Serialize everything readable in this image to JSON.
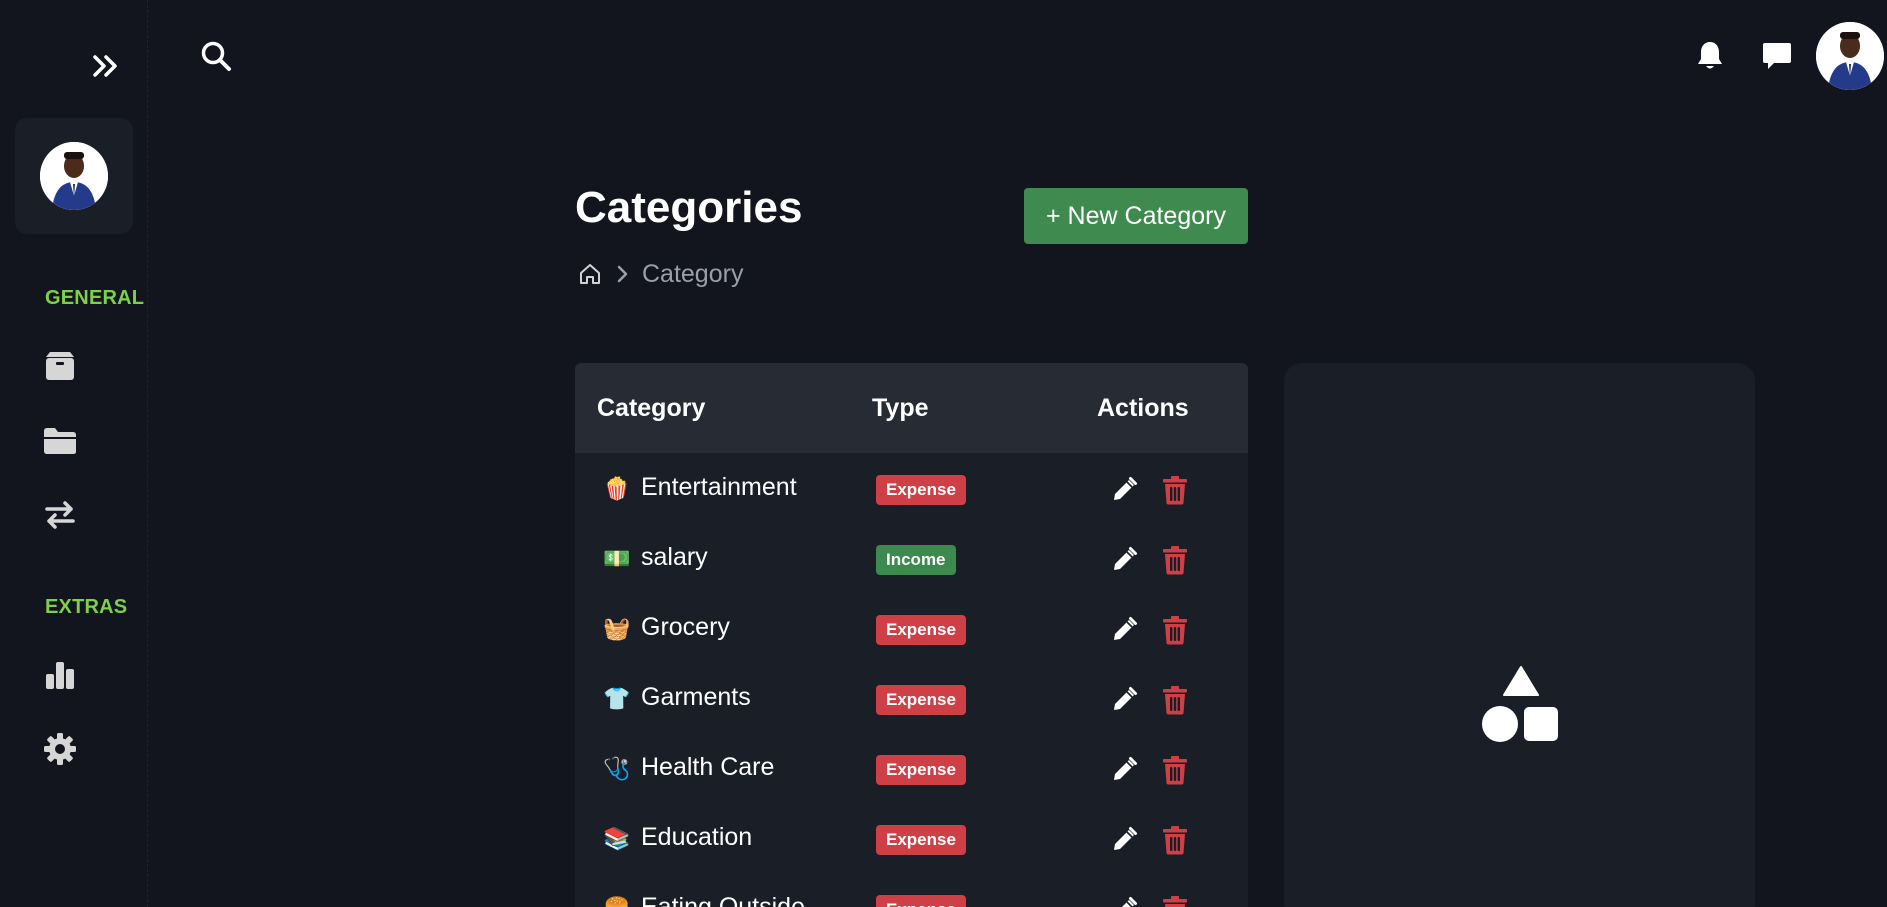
{
  "sidebar": {
    "toggle_icon": "double-chevron-right-icon",
    "sections": [
      {
        "label": "GENERAL",
        "items": [
          "box-icon",
          "folder-icon",
          "transfer-arrows-icon"
        ]
      },
      {
        "label": "EXTRAS",
        "items": [
          "bar-chart-icon",
          "gear-icon"
        ]
      }
    ]
  },
  "topbar": {
    "search_icon": "search-icon",
    "icons": [
      "bell-icon",
      "chat-icon"
    ]
  },
  "page": {
    "title": "Categories",
    "new_button": "+ New Category",
    "breadcrumb": {
      "home_icon": "home-icon",
      "separator_icon": "chevron-right-icon",
      "current": "Category"
    }
  },
  "table": {
    "headers": {
      "category": "Category",
      "type": "Type",
      "actions": "Actions"
    },
    "rows": [
      {
        "emoji": "🍿",
        "name": "Entertainment",
        "type": "Expense"
      },
      {
        "emoji": "💵",
        "name": "salary",
        "type": "Income"
      },
      {
        "emoji": "🧺",
        "name": "Grocery",
        "type": "Expense"
      },
      {
        "emoji": "👕",
        "name": "Garments",
        "type": "Expense"
      },
      {
        "emoji": "🩺",
        "name": "Health Care",
        "type": "Expense"
      },
      {
        "emoji": "📚",
        "name": "Education",
        "type": "Expense"
      },
      {
        "emoji": "🍔",
        "name": "Eating Outside",
        "type": "Expense"
      }
    ]
  },
  "preview": {
    "icon": "shapes-icon"
  },
  "colors": {
    "accent_green": "#7ed04b",
    "button_green": "#3f8a4f",
    "expense_red": "#cf3f46",
    "income_green": "#3d8a4e",
    "background": "#12151d"
  }
}
